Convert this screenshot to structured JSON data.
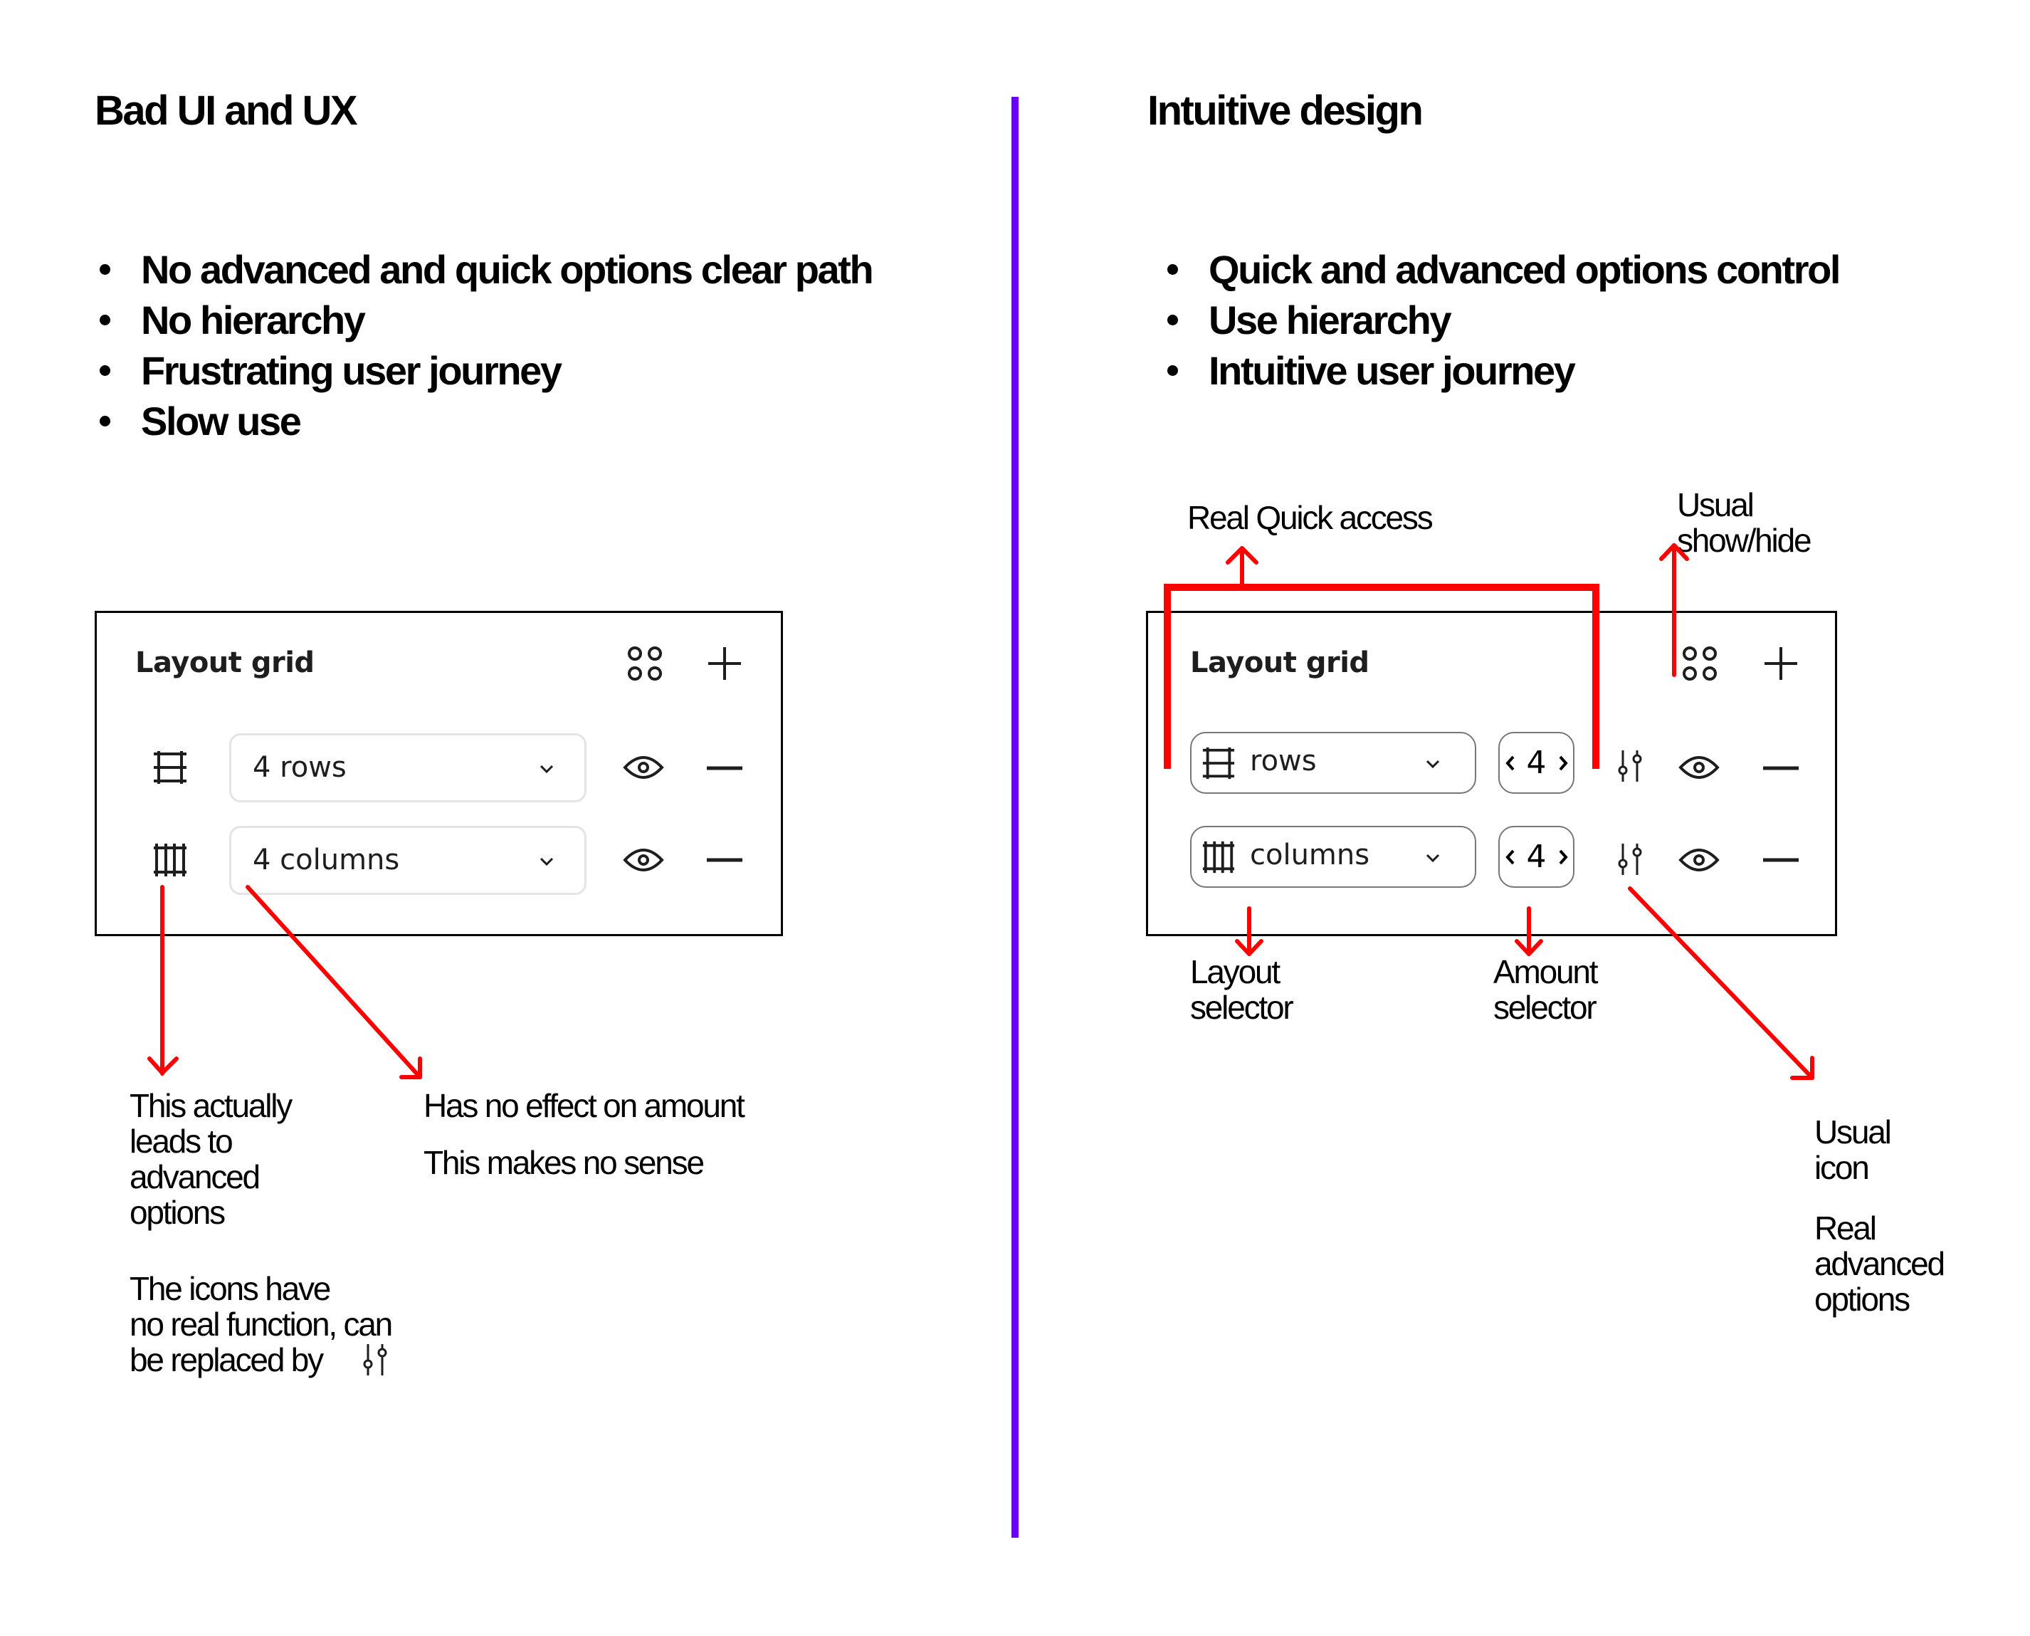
{
  "left": {
    "title": "Bad UI and UX",
    "bullets": [
      "No advanced and quick options clear path",
      "No hierarchy",
      "Frustrating user journey",
      "Slow  use"
    ],
    "panel": {
      "title": "Layout grid",
      "header_icons": [
        "grid-styles-icon",
        "plus-icon"
      ],
      "rows": [
        {
          "type_icon": "rows-grid-icon",
          "dropdown_value": "4 rows",
          "visibility_icon": "eye-icon",
          "remove_icon": "minus-icon"
        },
        {
          "type_icon": "columns-grid-icon",
          "dropdown_value": "4 columns",
          "visibility_icon": "eye-icon",
          "remove_icon": "minus-icon"
        }
      ]
    },
    "annotations": {
      "icon_note": [
        "This actually",
        "leads to",
        "advanced",
        "options"
      ],
      "dropdown_note_1": "Has no effect on amount",
      "dropdown_note_2": "This makes no sense",
      "icons_replace_note": [
        "The icons have",
        "no real function, can",
        "be replaced by"
      ],
      "icons_replace_icon": "sliders-icon"
    }
  },
  "right": {
    "title": "Intuitive design",
    "bullets": [
      "Quick and advanced options control",
      "Use hierarchy",
      "Intuitive user journey"
    ],
    "panel": {
      "title": "Layout grid",
      "header_icons": [
        "grid-styles-icon",
        "plus-icon"
      ],
      "rows": [
        {
          "type_icon": "rows-grid-icon",
          "dropdown_value": "rows",
          "amount": "4",
          "advanced_icon": "sliders-icon",
          "visibility_icon": "eye-icon",
          "remove_icon": "minus-icon"
        },
        {
          "type_icon": "columns-grid-icon",
          "dropdown_value": "columns",
          "amount": "4",
          "advanced_icon": "sliders-icon",
          "visibility_icon": "eye-icon",
          "remove_icon": "minus-icon"
        }
      ]
    },
    "annotations": {
      "quick_access": "Real Quick access",
      "show_hide": [
        "Usual",
        "show/hide"
      ],
      "layout_selector": [
        "Layout",
        "selector"
      ],
      "amount_selector": [
        "Amount",
        "selector"
      ],
      "usual_icon": [
        "Usual",
        "icon"
      ],
      "advanced_options": [
        "Real",
        "advanced",
        "options"
      ]
    }
  },
  "colors": {
    "divider": "#6A00FF",
    "annotation_arrow": "#FF0000",
    "text": "#000000",
    "panel_border": "#000000"
  }
}
